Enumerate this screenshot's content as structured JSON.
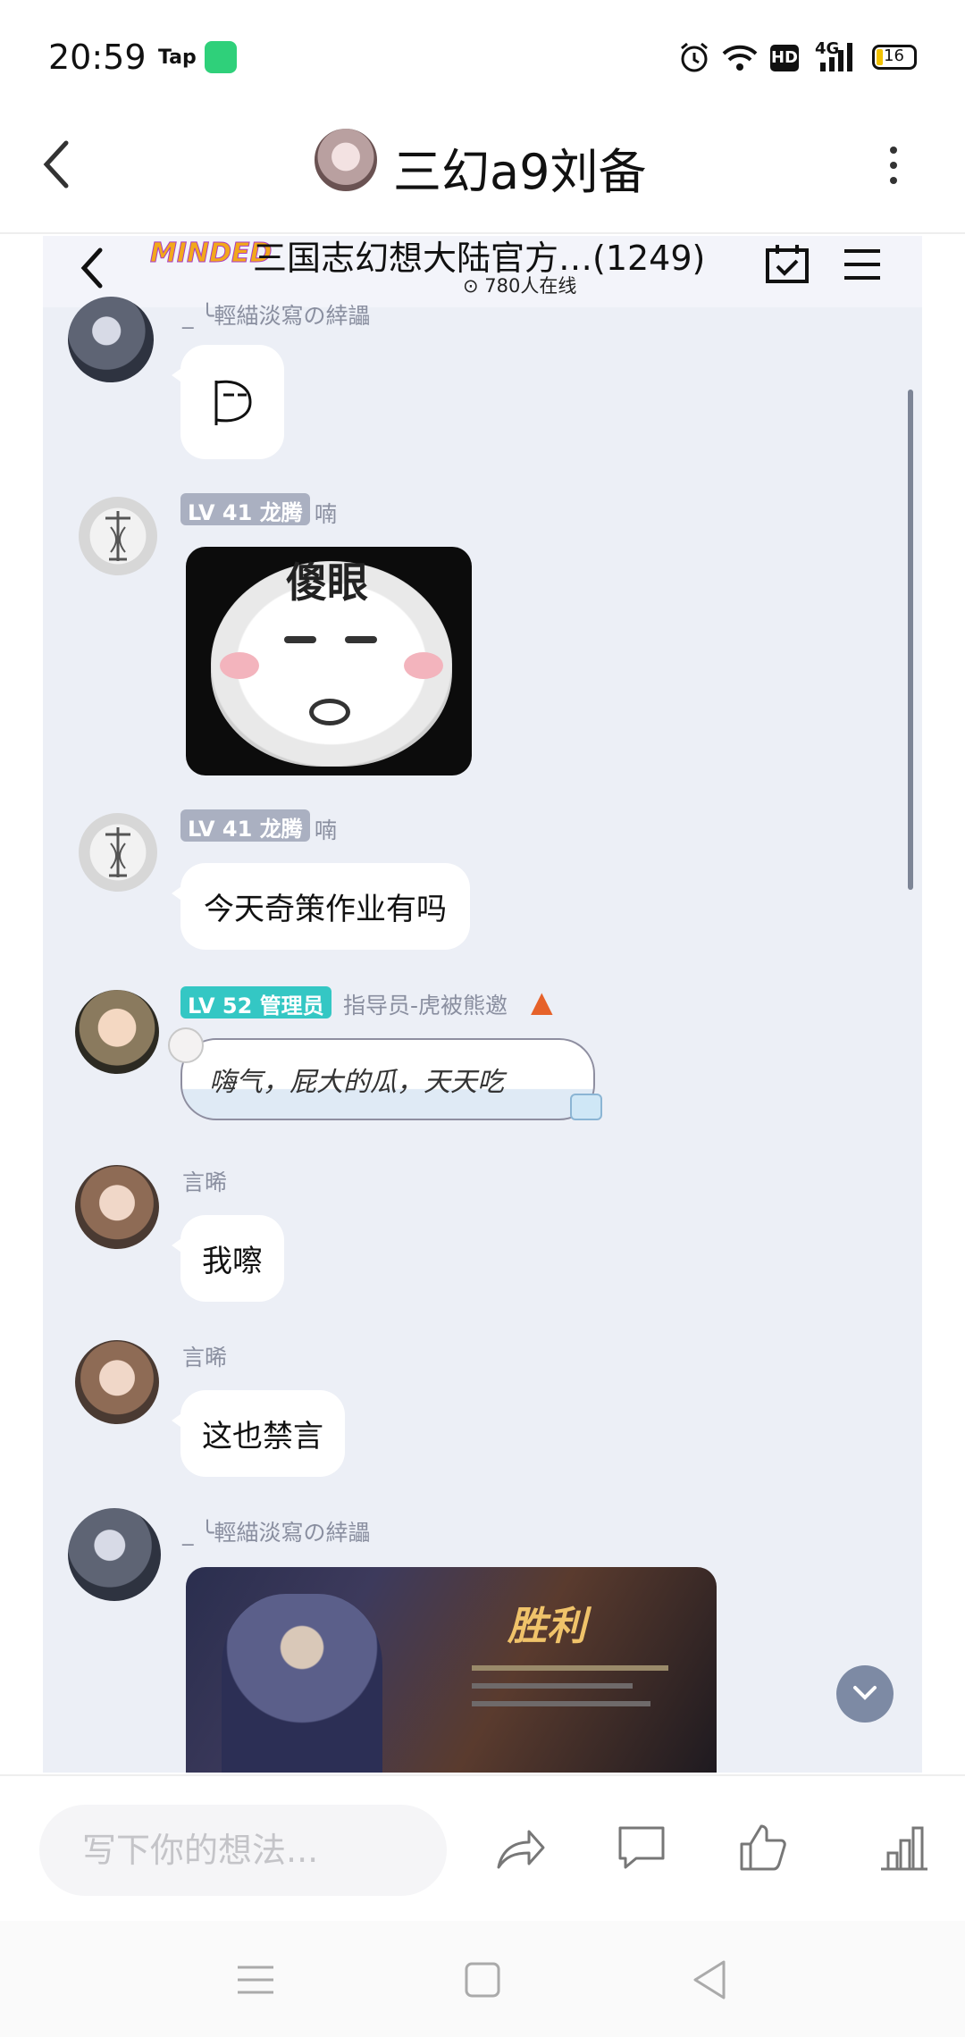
{
  "status_bar": {
    "time": "20:59",
    "tap_label": "Tap",
    "battery": "16",
    "network": "4G",
    "hd": "HD"
  },
  "app_bar": {
    "title": "三幻a9刘备"
  },
  "chat": {
    "group_title": "三国志幻想大陆官方…(1249)",
    "online_count": "780人在线",
    "logo_text": "MINDED",
    "messages": [
      {
        "sender": "_ ╰輕緢淡寫の緈讄",
        "type": "sticker"
      },
      {
        "level": "LV 41",
        "title": "龙腾",
        "sender": "喃",
        "type": "image",
        "image_text": "傻眼"
      },
      {
        "level": "LV 41",
        "title": "龙腾",
        "sender": "喃",
        "type": "text",
        "text": "今天奇策作业有吗"
      },
      {
        "level": "LV 52",
        "title": "管理员",
        "sender": "指导员-虎被熊邀",
        "type": "text",
        "text": "嗨气，屁大的瓜，天天吃"
      },
      {
        "sender": "言晞",
        "type": "text",
        "text": "我嚓"
      },
      {
        "sender": "言晞",
        "type": "text",
        "text": "这也禁言"
      },
      {
        "sender": "_ ╰輕緢淡寫の緈讄",
        "type": "image",
        "image_text": "胜利"
      }
    ]
  },
  "input_bar": {
    "placeholder": "写下你的想法..."
  }
}
